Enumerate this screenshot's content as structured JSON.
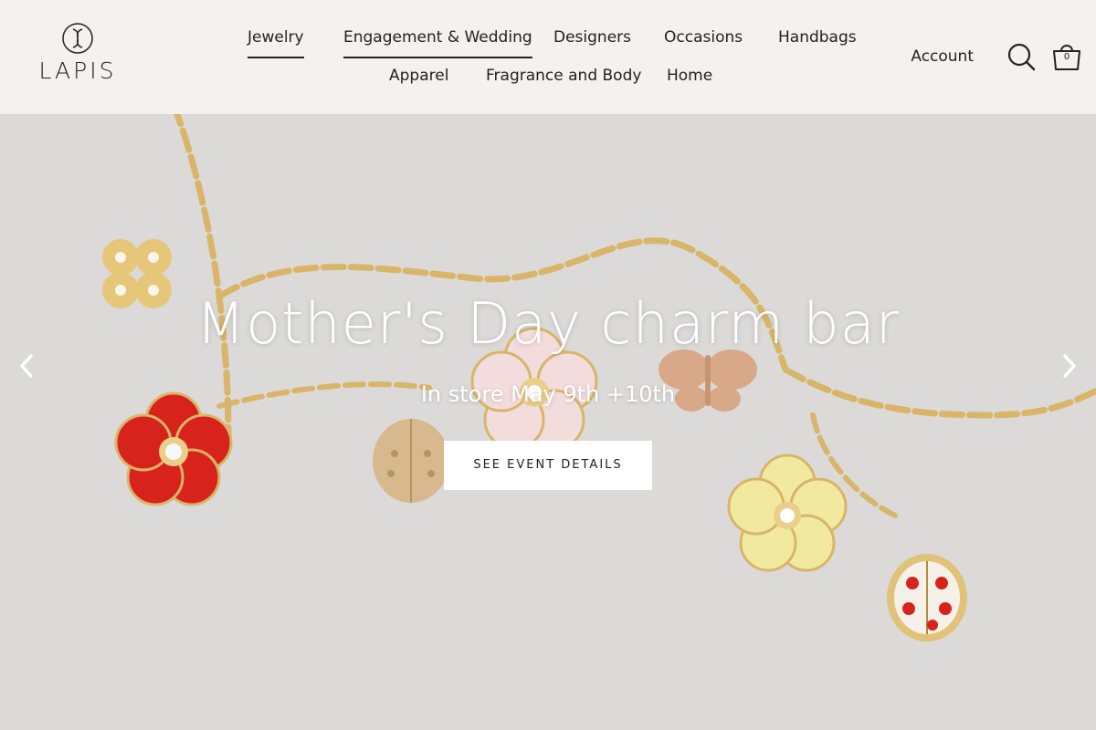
{
  "brand": {
    "logo_text": "LAPIS"
  },
  "nav": {
    "row1": [
      "Jewelry",
      "Engagement & Wedding",
      "Designers",
      "Occasions",
      "Handbags"
    ],
    "row2": [
      "Apparel",
      "Fragrance and Body",
      "Home"
    ]
  },
  "header": {
    "account_label": "Account",
    "cart_count": "0"
  },
  "hero": {
    "title": "Mother's Day charm bar",
    "subtitle": "In store May 9th +10th",
    "button_label": "SEE EVENT DETAILS"
  },
  "colors": {
    "header_bg": "#f4f1ee",
    "hero_bg": "#dcdad8",
    "gold": "#d9b56a",
    "red_enamel": "#d8231c",
    "pink_enamel": "#f3dcdc",
    "yellow_enamel": "#f2e9a0"
  },
  "icons": [
    "search-icon",
    "cart-icon",
    "chevron-left-icon",
    "chevron-right-icon"
  ]
}
